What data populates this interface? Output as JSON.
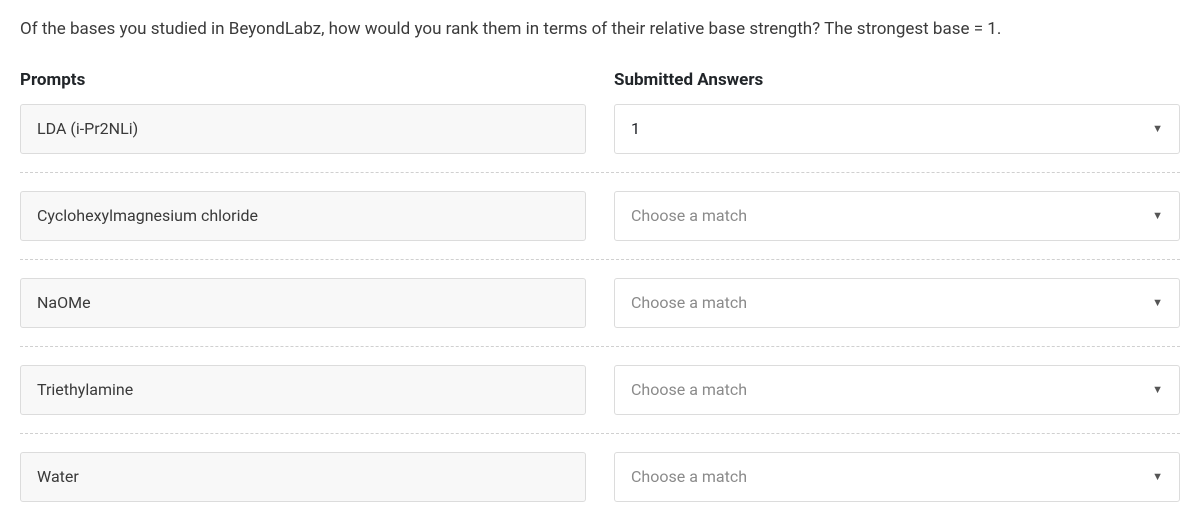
{
  "question": "Of the bases you studied in BeyondLabz, how would you rank them in terms of their relative base strength? The strongest base = 1.",
  "headers": {
    "prompts": "Prompts",
    "answers": "Submitted Answers"
  },
  "placeholder": "Choose a match",
  "rows": [
    {
      "prompt": "LDA (i-Pr2NLi)",
      "answer": "1"
    },
    {
      "prompt": "Cyclohexylmagnesium chloride",
      "answer": ""
    },
    {
      "prompt": "NaOMe",
      "answer": ""
    },
    {
      "prompt": "Triethylamine",
      "answer": ""
    },
    {
      "prompt": "Water",
      "answer": ""
    }
  ]
}
